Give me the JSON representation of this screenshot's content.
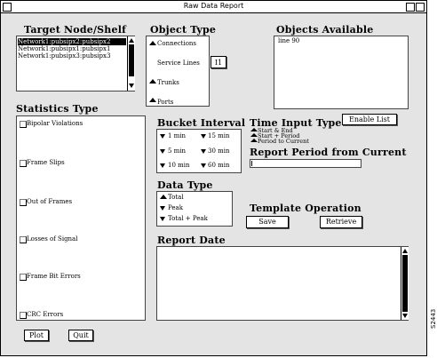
{
  "window": {
    "title": "Raw Data Report"
  },
  "target": {
    "label": "Target Node/Shelf",
    "items": [
      "Network1:pubsipx2:pubsipx2",
      "Network1:pubsipx1:pubsipx1",
      "Network1:pubsipx3:pubsipx3"
    ]
  },
  "object_type": {
    "label": "Object Type",
    "options": [
      "Connections",
      "Service Lines",
      "Trunks",
      "Ports"
    ],
    "selected": "Service Lines",
    "badge": "I1"
  },
  "objects_available": {
    "label": "Objects Available",
    "items": [
      "line 90"
    ]
  },
  "statistics": {
    "label": "Statistics Type",
    "items": [
      "Bipolar Violations",
      "Frame Slips",
      "Out of Frames",
      "Losses of Signal",
      "Frame Bit Errors",
      "CRC Errors"
    ]
  },
  "bucket": {
    "label": "Bucket Interval",
    "options": [
      "1 min",
      "15 min",
      "5 min",
      "30 min",
      "10 min",
      "60 min"
    ]
  },
  "time_input": {
    "label": "Time Input Type",
    "options": [
      "Start & End",
      "Start + Period",
      "Period to Current"
    ]
  },
  "enable_list": {
    "label": "Enable List"
  },
  "report_period": {
    "label": "Report Period from Current",
    "value": ""
  },
  "data_type": {
    "label": "Data Type",
    "options": [
      "Total",
      "Peak",
      "Total + Peak"
    ]
  },
  "template": {
    "label": "Template Operation",
    "save": "Save",
    "retrieve": "Retrieve"
  },
  "report_date": {
    "label": "Report Date",
    "value": ""
  },
  "footer": {
    "plot": "Plot",
    "quit": "Quit"
  },
  "figure_id": "S2443"
}
